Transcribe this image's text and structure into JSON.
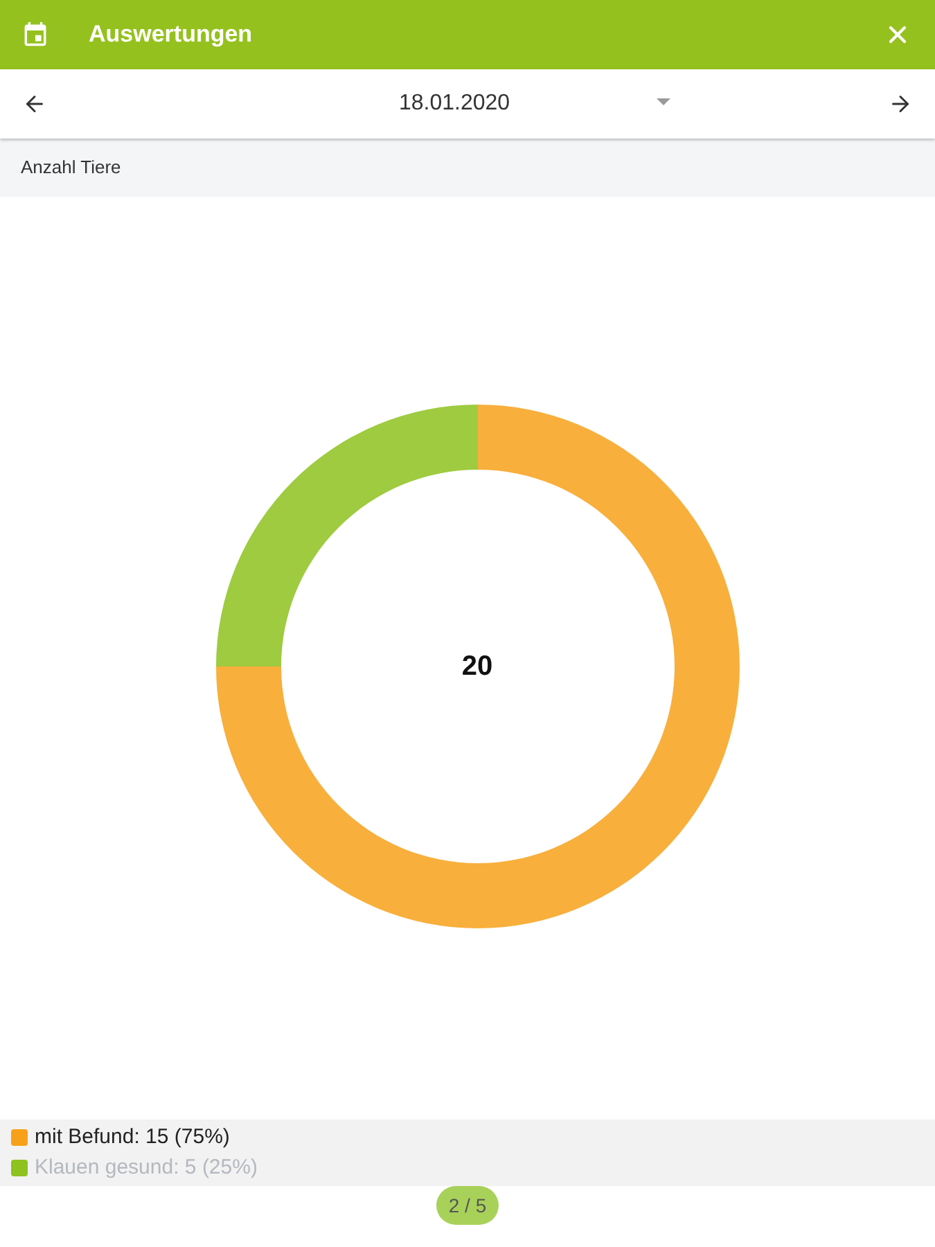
{
  "header": {
    "title": "Auswertungen"
  },
  "date_bar": {
    "date": "18.01.2020"
  },
  "section": {
    "title": "Anzahl Tiere"
  },
  "chart": {
    "center_label": "20",
    "chart_data": {
      "type": "donut",
      "categories": [
        "mit Befund",
        "Klauen gesund"
      ],
      "series": [
        {
          "values": [
            75,
            25
          ]
        }
      ]
    }
  },
  "legend": [
    {
      "detail": ": 15 (75%)",
      "color": "#f7a11a",
      "dimmed": false
    },
    {
      "detail": ": 5 (25%)",
      "color": "#8dc21f",
      "dimmed": true
    }
  ],
  "pager": {
    "label": "2 / 5"
  }
}
